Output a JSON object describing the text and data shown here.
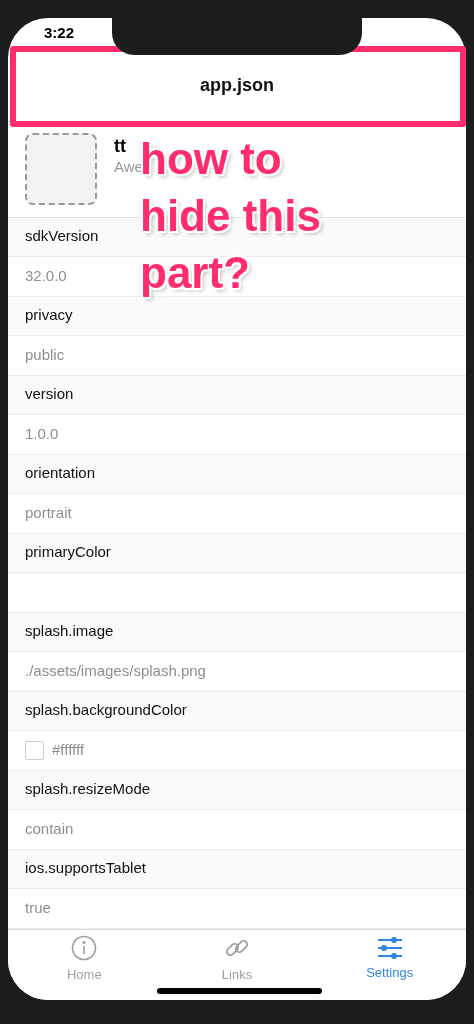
{
  "status_bar": {
    "time": "3:22"
  },
  "header": {
    "title": "app.json"
  },
  "app": {
    "name": "tt",
    "subtitle": "Awe"
  },
  "fields": [
    {
      "kind": "text",
      "label": "sdkVersion",
      "value": "32.0.0"
    },
    {
      "kind": "text",
      "label": "privacy",
      "value": "public"
    },
    {
      "kind": "text",
      "label": "version",
      "value": "1.0.0"
    },
    {
      "kind": "text",
      "label": "orientation",
      "value": "portrait"
    },
    {
      "kind": "text",
      "label": "primaryColor"
    },
    {
      "kind": "text",
      "label": "splash.image",
      "value": "./assets/images/splash.png"
    },
    {
      "kind": "color",
      "label": "splash.backgroundColor",
      "value": "#ffffff",
      "color": "#ffffff"
    },
    {
      "kind": "text",
      "label": "splash.resizeMode",
      "value": "contain"
    },
    {
      "kind": "text",
      "label": "ios.supportsTablet",
      "value": "true"
    }
  ],
  "tab_bar": [
    {
      "label": "Home",
      "kind": "info",
      "selected": false
    },
    {
      "label": "Links",
      "kind": "link",
      "selected": false
    },
    {
      "label": "Settings",
      "kind": "sliders",
      "selected": true
    }
  ],
  "annotation": {
    "text": "how to hide this part?"
  }
}
